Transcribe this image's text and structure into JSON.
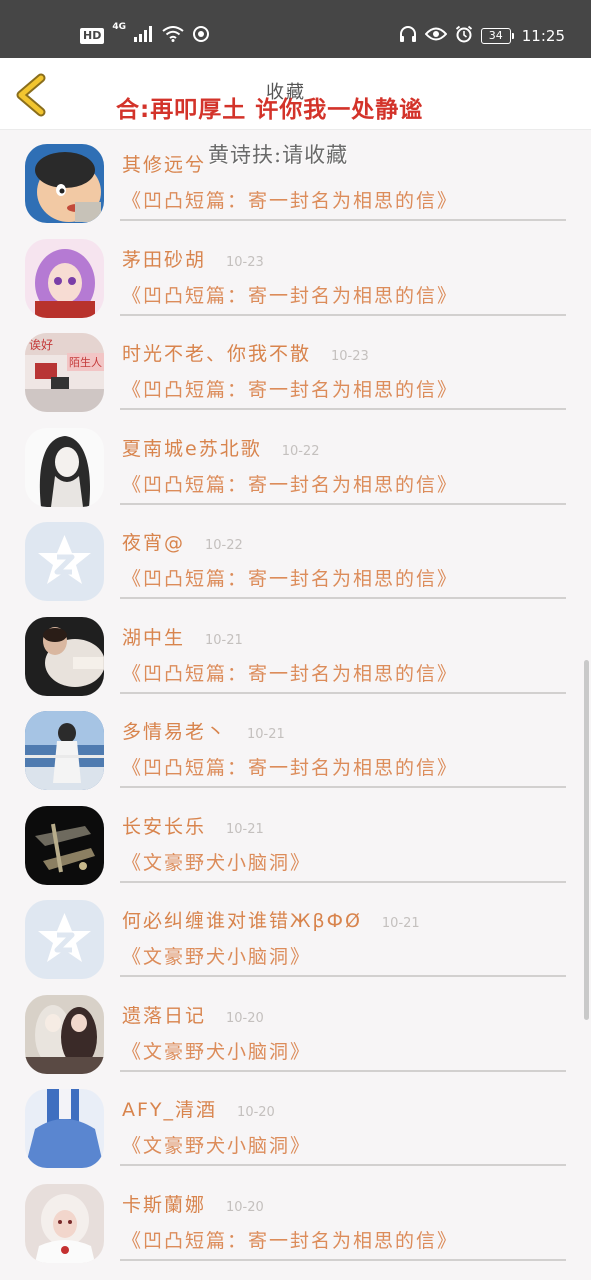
{
  "status_bar": {
    "hd": "HD",
    "network": "4G",
    "battery": "34",
    "time": "11:25"
  },
  "header": {
    "title": "合:再叩厚土 许你我一处静谧",
    "title_overlay": "收藏",
    "subtitle_overlay": "黄诗扶:请收藏"
  },
  "rows": [
    {
      "name": "其修远兮",
      "date": "",
      "group": "《凹凸短篇：寄一封名为相思的信》",
      "avatar": "cartoon-boy"
    },
    {
      "name": "茅田砂胡",
      "date": "10-23",
      "group": "《凹凸短篇：寄一封名为相思的信》",
      "avatar": "anime-purple"
    },
    {
      "name": "时光不老、你我不散",
      "date": "10-23",
      "group": "《凹凸短篇：寄一封名为相思的信》",
      "avatar": "photo-text"
    },
    {
      "name": "夏南城e苏北歌",
      "date": "10-22",
      "group": "《凹凸短篇：寄一封名为相思的信》",
      "avatar": "sketch-girl"
    },
    {
      "name": "夜宵@",
      "date": "10-22",
      "group": "《凹凸短篇：寄一封名为相思的信》",
      "avatar": "default"
    },
    {
      "name": "湖中生",
      "date": "10-21",
      "group": "《凹凸短篇：寄一封名为相思的信》",
      "avatar": "photo-dark"
    },
    {
      "name": "多情易老丶",
      "date": "10-21",
      "group": "《凹凸短篇：寄一封名为相思的信》",
      "avatar": "photo-sea"
    },
    {
      "name": "长安长乐",
      "date": "10-21",
      "group": "《文豪野犬小脑洞》",
      "avatar": "guns"
    },
    {
      "name": "何必纠缠谁对谁错ЖβФØ",
      "date": "10-21",
      "group": "《文豪野犬小脑洞》",
      "avatar": "default"
    },
    {
      "name": "遗落日记",
      "date": "10-20",
      "group": "《文豪野犬小脑洞》",
      "avatar": "anime-pair"
    },
    {
      "name": "AFY_清酒",
      "date": "10-20",
      "group": "《文豪野犬小脑洞》",
      "avatar": "anime-blue"
    },
    {
      "name": "卡斯蘭娜",
      "date": "10-20",
      "group": "《凹凸短篇：寄一封名为相思的信》",
      "avatar": "cosplay-white"
    }
  ],
  "colors": {
    "title_red": "#d3332a",
    "name_orange": "#d8844d",
    "date_gray": "#c4c0be",
    "back_yellow": "#f2c530"
  }
}
